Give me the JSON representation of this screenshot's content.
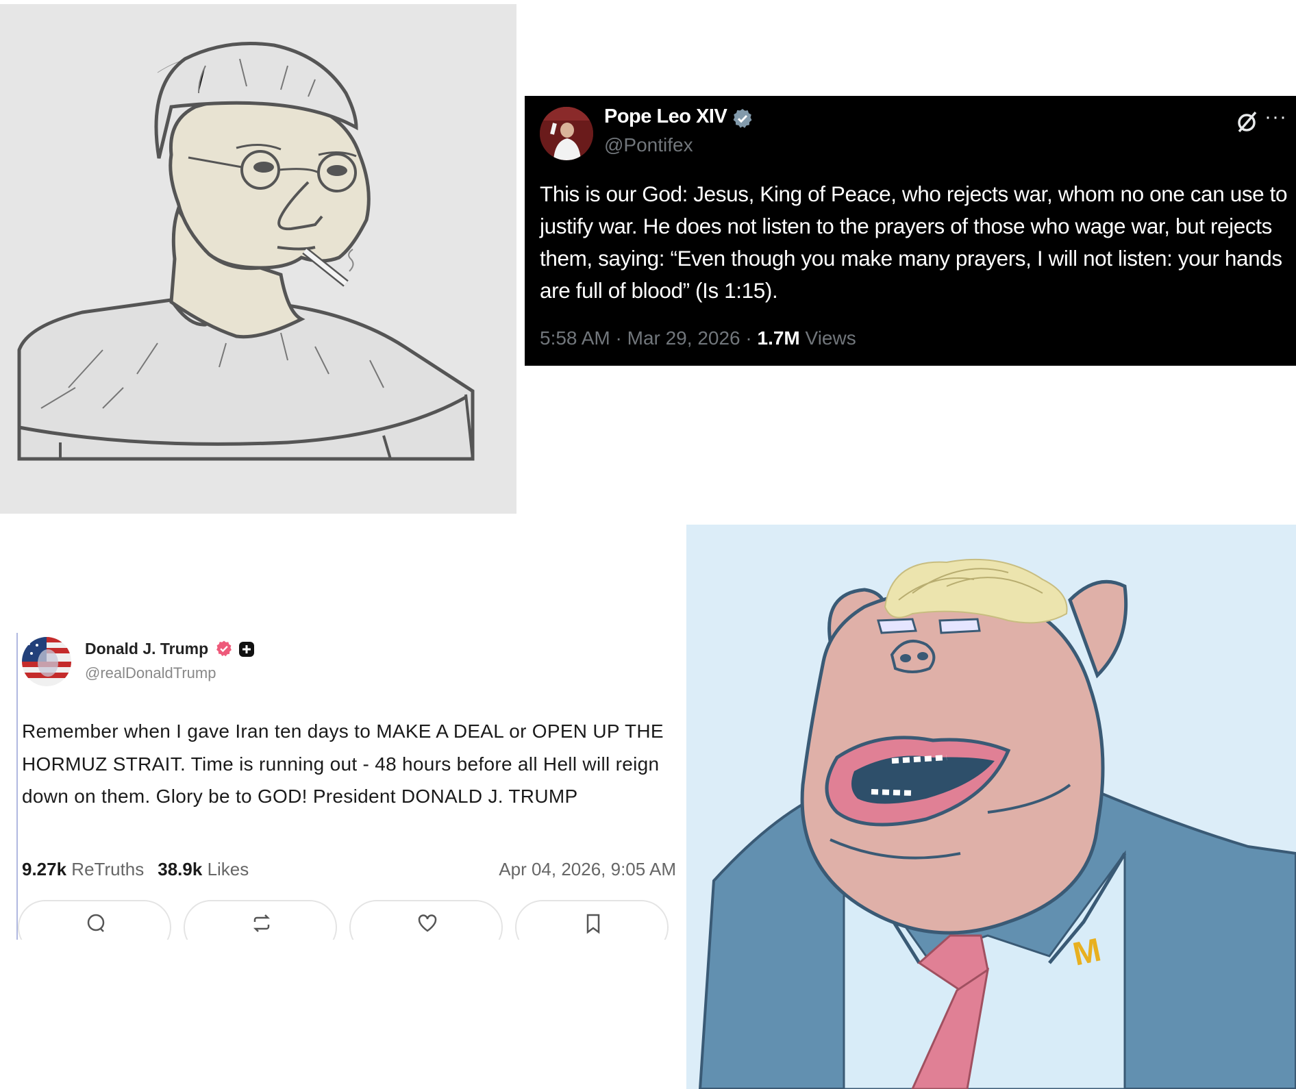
{
  "pope_tweet": {
    "name": "Pope Leo XIV",
    "handle": "@Pontifex",
    "text": "This is our God: Jesus, King of Peace, who rejects war, whom no one can use to justify war.  He does not listen to the prayers of those who wage war, but rejects them, saying: “Even though you make many prayers, I will not listen: your hands are full of blood” (Is 1:15).",
    "timestamp": "5:58 AM · Mar 29, 2026 · ",
    "views_count": "1.7M",
    "views_label": " Views",
    "more_glyph": "···",
    "icons": [
      "verified-badge-icon",
      "grok-icon",
      "more-icon"
    ],
    "colors": {
      "background": "#000000",
      "verified": "#829aab",
      "muted": "#71767b"
    }
  },
  "trump_post": {
    "name": "Donald J. Trump",
    "handle": "@realDonaldTrump",
    "text": "Remember when I gave Iran ten days to MAKE A DEAL or OPEN UP THE HORMUZ STRAIT. Time is running out - 48 hours before all Hell will reign down on them. Glory be to GOD! President DONALD J. TRUMP",
    "retruths_count": "9.27k",
    "retruths_label": " ReTruths",
    "likes_count": "38.9k",
    "likes_label": " Likes",
    "date": "Apr 04, 2026, 9:05 AM",
    "actions": [
      "reply-icon",
      "retruth-icon",
      "like-icon",
      "bookmark-icon"
    ],
    "colors": {
      "verified": "#ee5a7a",
      "muted": "#666666"
    }
  },
  "wojak_drawing": {
    "subject": "wojak-with-cigarette",
    "skin": "#e8e3d2",
    "shirt": "#e0e0e0",
    "background": "#e6e6e6"
  },
  "pig_drawing": {
    "subject": "pig-caricature-in-suit",
    "skin": "#dfb0a8",
    "suit": "#6290b0",
    "tie": "#e08095",
    "hair": "#e8e0a8",
    "pin_glyph": "M",
    "background": "#dcedf8"
  }
}
